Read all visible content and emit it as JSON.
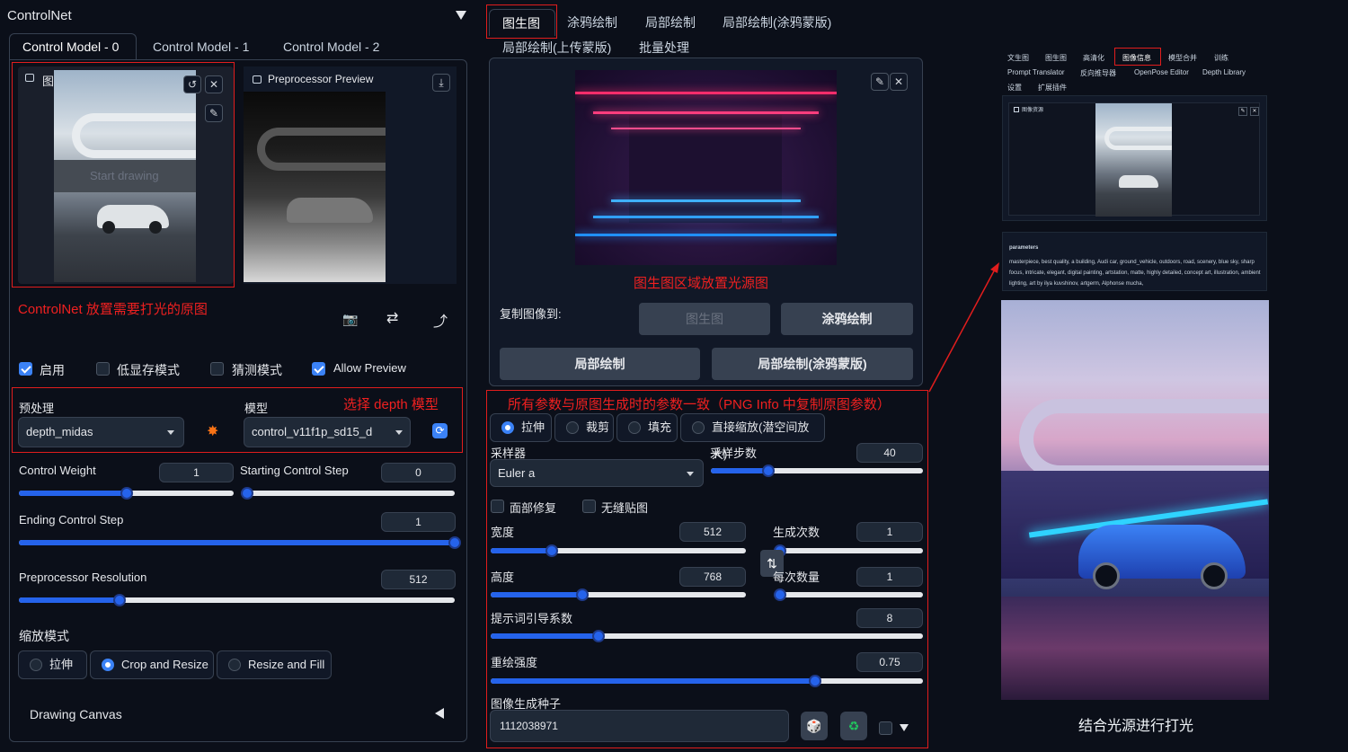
{
  "left": {
    "title": "ControlNet",
    "tabs": [
      "Control Model - 0",
      "Control Model - 1",
      "Control Model - 2"
    ],
    "image_label": "图像",
    "watermark_text": "Start drawing",
    "preview_label": "Preprocessor Preview",
    "annotation_image": "ControlNet 放置需要打光的原图",
    "checkboxes": [
      {
        "label": "启用",
        "checked": true
      },
      {
        "label": "低显存模式",
        "checked": false
      },
      {
        "label": "猜测模式",
        "checked": false
      },
      {
        "label": "Allow Preview",
        "checked": true
      }
    ],
    "preprocessor_label": "预处理",
    "preprocessor_value": "depth_midas",
    "model_label": "模型",
    "model_value": "control_v11f1p_sd15_d",
    "annotation_model": "选择 depth 模型",
    "control_weight": {
      "label": "Control Weight",
      "value": "1",
      "fraction": 0.5
    },
    "starting_step": {
      "label": "Starting Control Step",
      "value": "0",
      "fraction": 0.0
    },
    "ending_step": {
      "label": "Ending Control Step",
      "value": "1",
      "fraction": 1.0
    },
    "preproc_res": {
      "label": "Preprocessor Resolution",
      "value": "512",
      "fraction": 0.23
    },
    "resize_mode_label": "缩放模式",
    "resize_modes": [
      {
        "label": "拉伸",
        "selected": false
      },
      {
        "label": "Crop and Resize",
        "selected": true
      },
      {
        "label": "Resize and Fill",
        "selected": false
      }
    ],
    "drawing_canvas": "Drawing Canvas"
  },
  "middle": {
    "tabs": [
      "图生图",
      "涂鸦绘制",
      "局部绘制",
      "局部绘制(涂鸦蒙版)",
      "局部绘制(上传蒙版)",
      "批量处理"
    ],
    "annotation_image": "图生图区域放置光源图",
    "copy_to_label": "复制图像到:",
    "copy_buttons": [
      "图生图",
      "涂鸦绘制",
      "局部绘制",
      "局部绘制(涂鸦蒙版)"
    ],
    "annotation_params": "所有参数与原图生成时的参数一致（PNG Info 中复制原图参数）",
    "resize_modes": [
      {
        "label": "拉伸",
        "selected": true
      },
      {
        "label": "裁剪",
        "selected": false
      },
      {
        "label": "填充",
        "selected": false
      },
      {
        "label": "直接缩放(潜空间放大)",
        "selected": false
      }
    ],
    "sampler_label": "采样器",
    "sampler_value": "Euler a",
    "steps": {
      "label": "采样步数",
      "value": "40",
      "fraction": 0.27
    },
    "face_restore": "面部修复",
    "tiling": "无缝贴图",
    "width": {
      "label": "宽度",
      "value": "512",
      "fraction": 0.24
    },
    "height": {
      "label": "高度",
      "value": "768",
      "fraction": 0.36
    },
    "batch_count": {
      "label": "生成次数",
      "value": "1",
      "fraction": 0.0
    },
    "batch_size": {
      "label": "每次数量",
      "value": "1",
      "fraction": 0.0
    },
    "cfg": {
      "label": "提示词引导系数",
      "value": "8",
      "fraction": 0.25
    },
    "denoise": {
      "label": "重绘强度",
      "value": "0.75",
      "fraction": 0.75
    },
    "seed_label": "图像生成种子",
    "seed_value": "1112038971"
  },
  "right": {
    "tabs_row1": [
      "文生图",
      "图生图",
      "高清化",
      "图像信息",
      "模型合并",
      "训练"
    ],
    "tabs_row2": [
      "Prompt Translator",
      "反向推导器",
      "OpenPose Editor",
      "Depth Library"
    ],
    "tabs_row3": [
      "设置",
      "扩展插件"
    ],
    "source_label": "图像资源",
    "params_title": "parameters",
    "params_text": "masterpiece, best quality, a building, Audi car, ground_vehicle, outdoors, road, scenery, blue sky, sharp focus, intricate, elegant, digital painting, artstation, matte, highly detailed, concept art, illustration, ambient lighting, art by ilya kuvshinov, artgerm, Alphonse mucha,",
    "caption": "结合光源进行打光"
  },
  "colors": {
    "accent": "#2563eb",
    "annotation": "#e11d1d",
    "background": "#0b0f19"
  }
}
